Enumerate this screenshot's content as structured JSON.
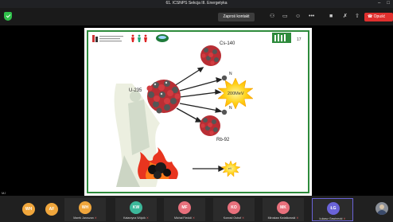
{
  "window": {
    "title": "61. ICSNPS Sekcja III. Energetyka",
    "controls": [
      "–",
      "□"
    ]
  },
  "toolbar": {
    "invite_label": "Zaproś kontakt",
    "icons": [
      "people-icon",
      "chat-icon",
      "reactions-icon",
      "more-icon",
      "camera-icon",
      "mic-icon",
      "share-icon"
    ],
    "leave_label": "Opuść",
    "leave_color": "#e0302e"
  },
  "stage": {
    "corner_label": "MJ"
  },
  "slide": {
    "page_number": "17",
    "nucleus_label": "U-235",
    "product1_label": "Cs-140",
    "product2_label": "Rb-92",
    "neutron1_label": "N",
    "neutron2_label": "N",
    "energy_label": "200MeV",
    "small_energy_label": "eV",
    "frame_color": "#2e8b3c"
  },
  "participants": {
    "left_avatars": [
      {
        "initials": "WH",
        "color": "#f0a63c"
      },
      {
        "initials": "AF",
        "color": "#f0a63c"
      }
    ],
    "tiles": [
      {
        "initials": "WH",
        "name": "Marek Jaroszan",
        "color": "#f0a63c"
      },
      {
        "initials": "KW",
        "name": "Katarzyna Wójcik",
        "color": "#3cb89a"
      },
      {
        "initials": "MF",
        "name": "Michał Fiedoli",
        "color": "#e8707c"
      },
      {
        "initials": "KO",
        "name": "Konrad Ostrof",
        "color": "#e8707c"
      },
      {
        "initials": "MK",
        "name": "Mirosław Kwiatkowski",
        "color": "#e8707c"
      },
      {
        "initials": "ŁG",
        "name": "Łukasz Gawinecki",
        "color": "#6a63d8"
      }
    ]
  }
}
